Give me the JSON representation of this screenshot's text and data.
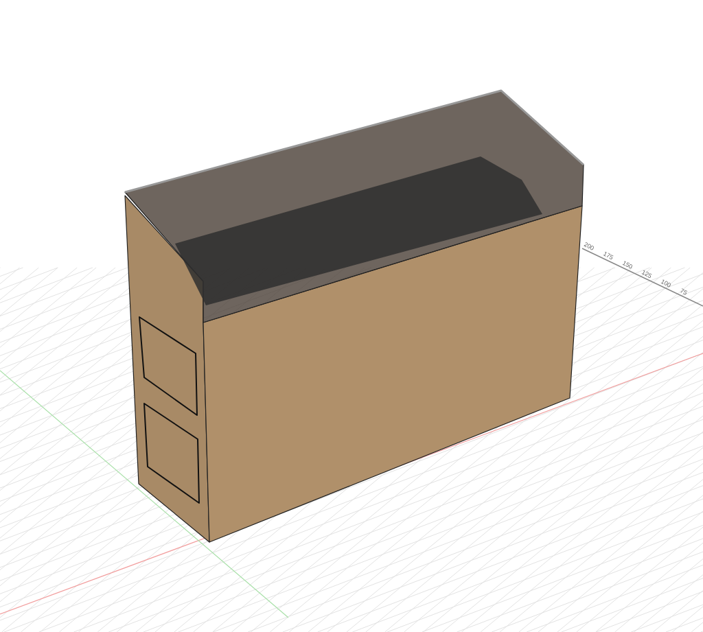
{
  "viewport": {
    "ruler": {
      "labels": [
        "200",
        "175",
        "150",
        "125",
        "100",
        "75"
      ]
    }
  }
}
